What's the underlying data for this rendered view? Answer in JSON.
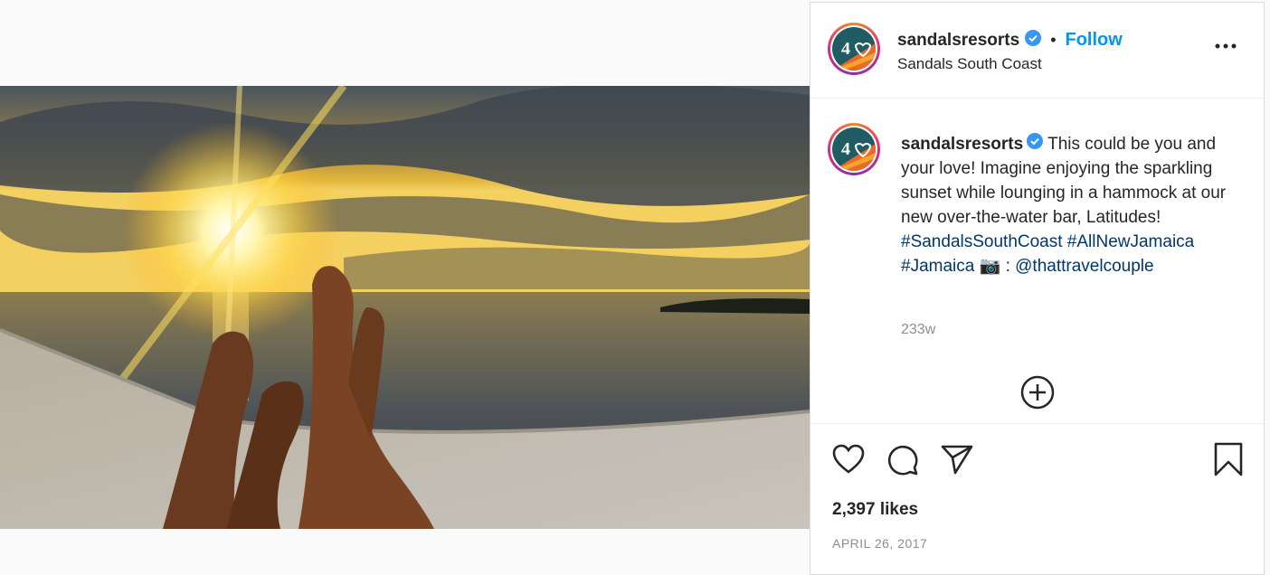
{
  "post": {
    "username": "sandalsresorts",
    "follow_label": "Follow",
    "separator": "•",
    "location": "Sandals South Coast",
    "caption": {
      "username": "sandalsresorts",
      "text": "This could be you and your love! Imagine enjoying the sparkling sunset while lounging in a hammock at our new over-the-water bar, Latitudes!",
      "hashtags": [
        "#SandalsSouthCoast",
        "#AllNewJamaica",
        "#Jamaica"
      ],
      "camera_emoji": "📷",
      "credit_sep": ":",
      "mention": "@thattravelcouple",
      "time_ago": "233w"
    },
    "likes": "2,397 likes",
    "date": "APRIL 26, 2017"
  },
  "icons": {
    "verified": "verified-badge-icon",
    "more": "more-options-icon",
    "add_comment": "add-circle-icon",
    "like": "heart-icon",
    "comment": "comment-bubble-icon",
    "share": "paper-plane-icon",
    "save": "bookmark-icon"
  },
  "colors": {
    "accent": "#0095f6",
    "hashtag": "#00376b",
    "muted": "#8e8e8e",
    "text": "#262626"
  }
}
